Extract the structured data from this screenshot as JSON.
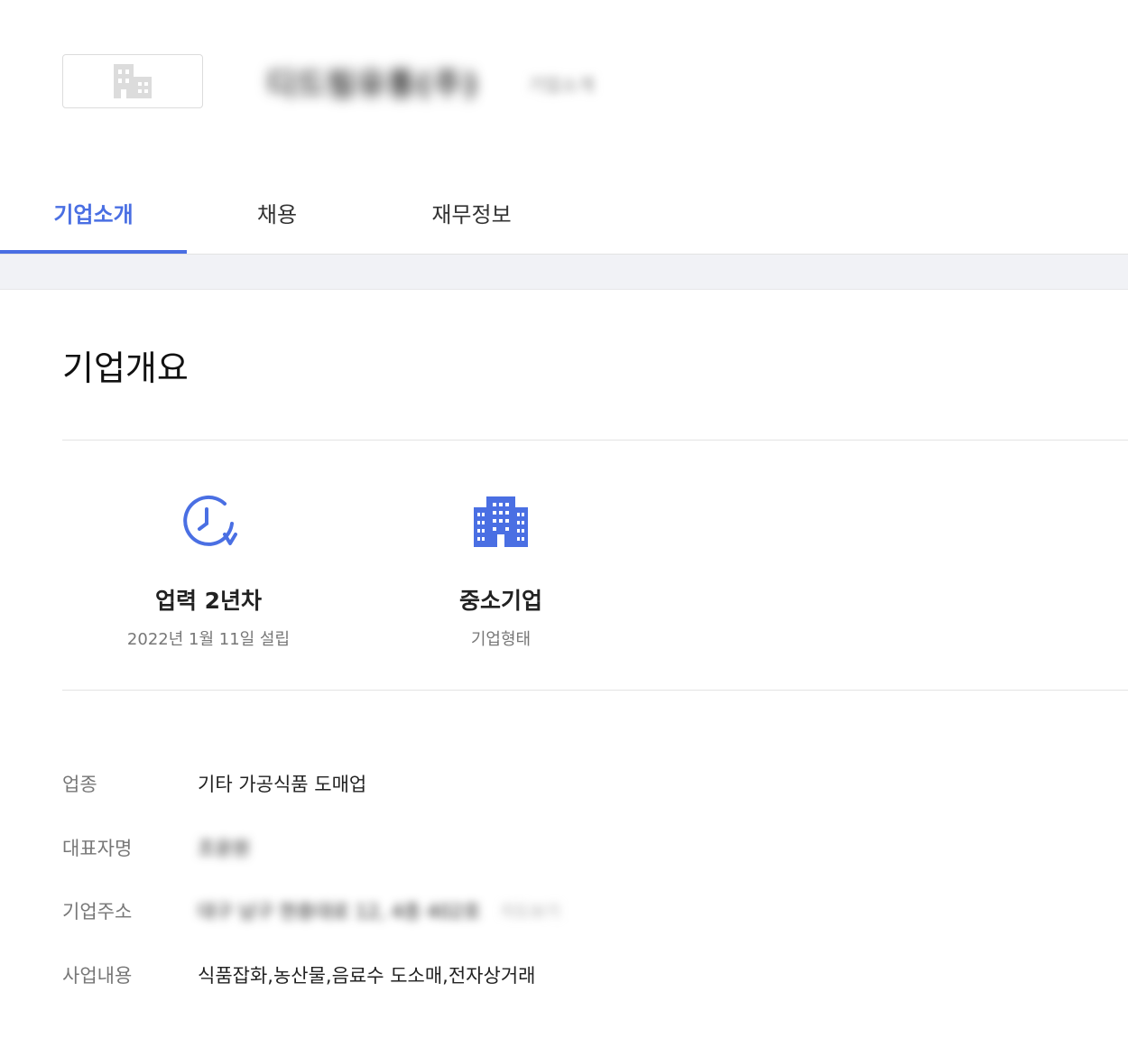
{
  "header": {
    "company_name": "디드림유통(주)",
    "company_sub": "기업소개"
  },
  "tabs": [
    {
      "label": "기업소개",
      "active": true
    },
    {
      "label": "채용",
      "active": false
    },
    {
      "label": "재무정보",
      "active": false
    }
  ],
  "section": {
    "title": "기업개요"
  },
  "stats": [
    {
      "icon": "clock-icon",
      "value": "업력 2년차",
      "caption": "2022년 1월 11일 설립"
    },
    {
      "icon": "building-icon",
      "value": "중소기업",
      "caption": "기업형태"
    }
  ],
  "info": [
    {
      "label": "업종",
      "value": "기타 가공식품 도매업"
    },
    {
      "label": "대표자명",
      "value": "조윤원"
    },
    {
      "label": "기업주소",
      "value": "대구 남구 현충대로 12, 4층 402호",
      "extra": "지도보기"
    },
    {
      "label": "사업내용",
      "value": "식품잡화,농산물,음료수 도소매,전자상거래"
    }
  ],
  "colors": {
    "accent": "#4a6fe3",
    "band": "#f1f2f6",
    "divider": "#e3e3e3"
  }
}
